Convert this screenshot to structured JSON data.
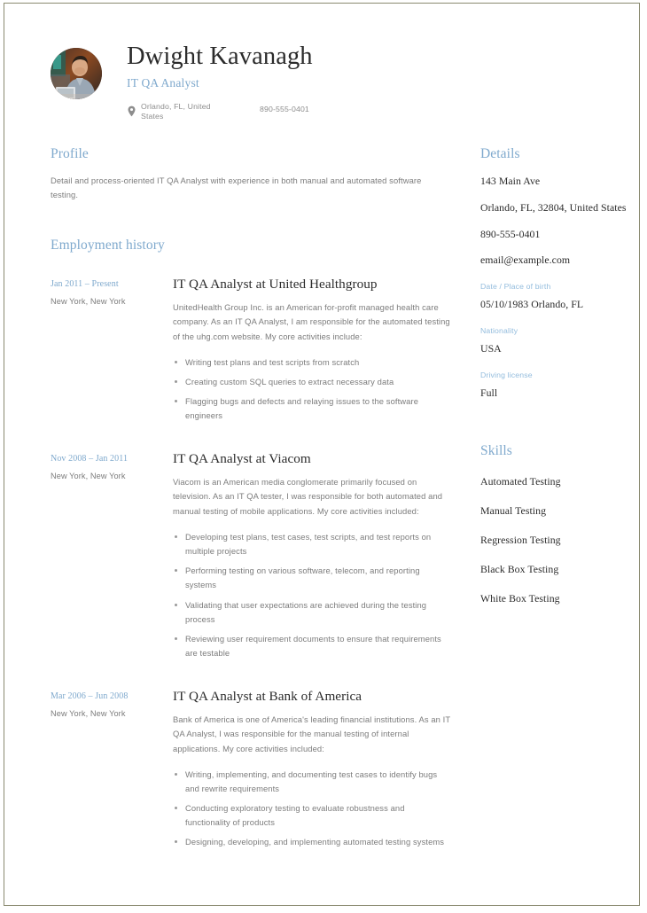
{
  "header": {
    "name": "Dwight Kavanagh",
    "job_title": "IT QA Analyst",
    "location": "Orlando, FL, United States",
    "phone": "890-555-0401",
    "location_icon": "map-pin-icon",
    "avatar_alt": "profile-photo"
  },
  "profile": {
    "heading": "Profile",
    "text": "Detail and process-oriented IT QA Analyst with experience in both manual and automated software testing."
  },
  "employment": {
    "heading": "Employment history",
    "jobs": [
      {
        "date": "Jan 2011 – Present",
        "location": "New York, New York",
        "title": "IT QA Analyst at United Healthgroup",
        "description": "UnitedHealth Group Inc. is an American for-profit managed health care company. As an IT QA Analyst, I am responsible for the automated testing of the uhg.com website. My core activities include:",
        "bullets": [
          "Writing test plans and test scripts from scratch",
          "Creating custom SQL queries to extract necessary data",
          "Flagging bugs and defects and relaying issues to the software engineers"
        ]
      },
      {
        "date": "Nov 2008 – Jan 2011",
        "location": "New York, New York",
        "title": "IT QA Analyst at Viacom",
        "description": "Viacom is an American media conglomerate primarily focused on television. As an IT QA tester, I was responsible for both automated and manual testing of mobile applications. My core activities included:",
        "bullets": [
          "Developing test plans, test cases, test scripts, and test reports on multiple projects",
          "Performing testing on various software, telecom, and reporting systems",
          "Validating that user expectations are achieved during the testing process",
          "Reviewing user requirement documents to ensure that requirements are testable"
        ]
      },
      {
        "date": "Mar 2006 – Jun 2008",
        "location": "New York, New York",
        "title": "IT QA Analyst at Bank of America",
        "description": "Bank of America is one of America's leading financial institutions. As an IT QA Analyst, I was responsible for the manual testing of internal applications. My core activities included:",
        "bullets": [
          "Writing, implementing, and documenting test cases to identify bugs and rewrite requirements",
          "Conducting exploratory testing to evaluate robustness and functionality of products",
          "Designing, developing, and implementing automated testing systems"
        ]
      }
    ]
  },
  "details": {
    "heading": "Details",
    "address_line1": "143 Main Ave",
    "address_line2": "Orlando, FL, 32804, United States",
    "phone": "890-555-0401",
    "email": "email@example.com",
    "dob_label": "Date / Place of birth",
    "dob_value": "05/10/1983 Orlando, FL",
    "nationality_label": "Nationality",
    "nationality_value": "USA",
    "driving_label": "Driving license",
    "driving_value": "Full"
  },
  "skills": {
    "heading": "Skills",
    "items": [
      "Automated Testing",
      "Manual Testing",
      "Regression Testing",
      "Black Box Testing",
      "White Box Testing"
    ]
  },
  "colors": {
    "accent_blue": "#7fa9cd",
    "label_blue": "#93bcdd",
    "body_gray": "#7c7c7c",
    "heading_dark": "#2b2b2b",
    "frame": "#8a8a70"
  }
}
